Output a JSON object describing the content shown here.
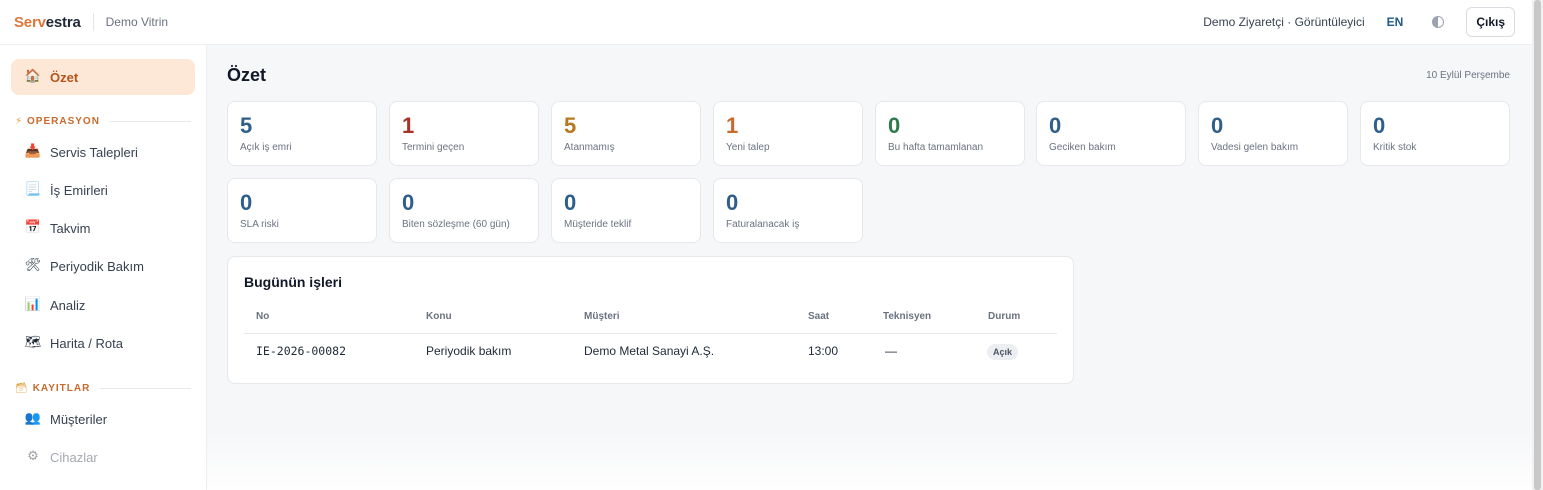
{
  "brand": {
    "name_accent": "Serv",
    "name_rest": "estra",
    "tenant": "Demo Vitrin"
  },
  "topbar": {
    "user": "Demo Ziyaretçi · Görüntüleyici",
    "lang": "EN",
    "theme_icon": "half-circle-icon",
    "logout_label": "Çıkış"
  },
  "sidebar": {
    "active": {
      "icon": "🏠",
      "label": "Özet"
    },
    "sections": [
      {
        "icon": "⚡",
        "label": "OPERASYON"
      },
      {
        "icon": "🗃",
        "label": "KAYITLAR"
      }
    ],
    "items": [
      {
        "icon": "📥",
        "label": "Servis Talepleri"
      },
      {
        "icon": "📃",
        "label": "İş Emirleri"
      },
      {
        "icon": "📅",
        "label": "Takvim"
      },
      {
        "icon": "🛠",
        "label": "Periyodik Bakım"
      },
      {
        "icon": "📊",
        "label": "Analiz"
      },
      {
        "icon": "🗺",
        "label": "Harita / Rota"
      },
      {
        "icon": "👥",
        "label": "Müşteriler"
      },
      {
        "icon": "⚙",
        "label": "Cihazlar"
      }
    ]
  },
  "page": {
    "title": "Özet",
    "date": "10 Eylül Perşembe"
  },
  "stats": [
    {
      "value": "5",
      "label": "Açık iş emri",
      "color": "#2e5f8a"
    },
    {
      "value": "1",
      "label": "Termini geçen",
      "color": "#a93226"
    },
    {
      "value": "5",
      "label": "Atanmamış",
      "color": "#b7791f"
    },
    {
      "value": "1",
      "label": "Yeni talep",
      "color": "#c76a2b"
    },
    {
      "value": "0",
      "label": "Bu hafta tamamlanan",
      "color": "#2f7a4b"
    },
    {
      "value": "0",
      "label": "Geciken bakım",
      "color": "#2e5f8a"
    },
    {
      "value": "0",
      "label": "Vadesi gelen bakım",
      "color": "#2e5f8a"
    },
    {
      "value": "0",
      "label": "Kritik stok",
      "color": "#2e5f8a"
    },
    {
      "value": "0",
      "label": "SLA riski",
      "color": "#2e5f8a"
    },
    {
      "value": "0",
      "label": "Biten sözleşme (60 gün)",
      "color": "#2e5f8a"
    },
    {
      "value": "0",
      "label": "Müşteride teklif",
      "color": "#2e5f8a"
    },
    {
      "value": "0",
      "label": "Faturalanacak iş",
      "color": "#2e5f8a"
    }
  ],
  "jobs": {
    "title": "Bugünün işleri",
    "columns": [
      "No",
      "Konu",
      "Müşteri",
      "Saat",
      "Teknisyen",
      "Durum"
    ],
    "rows": [
      {
        "no": "IE-2026-00082",
        "subject": "Periyodik bakım",
        "customer": "Demo Metal Sanayi A.Ş.",
        "time": "13:00",
        "technician": "—",
        "status": "Açık"
      }
    ]
  }
}
